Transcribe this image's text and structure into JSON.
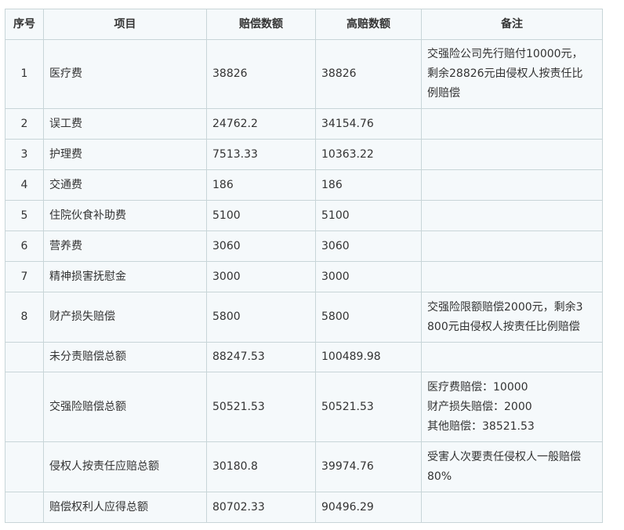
{
  "headers": [
    "序号",
    "项目",
    "赔偿数额",
    "高赔数额",
    "备注"
  ],
  "rows": [
    {
      "idx": "1",
      "item": "医疗费",
      "amount": "38826",
      "high": "38826",
      "note": [
        "交强险公司先行赔付10000元，",
        "剩余28826元由侵权人按责任比",
        "例赔偿"
      ]
    },
    {
      "idx": "2",
      "item": "误工费",
      "amount": "24762.2",
      "high": "34154.76",
      "note": []
    },
    {
      "idx": "3",
      "item": "护理费",
      "amount": "7513.33",
      "high": "10363.22",
      "note": []
    },
    {
      "idx": "4",
      "item": "交通费",
      "amount": "186",
      "high": "186",
      "note": []
    },
    {
      "idx": "5",
      "item": "住院伙食补助费",
      "amount": "5100",
      "high": "5100",
      "note": []
    },
    {
      "idx": "6",
      "item": "营养费",
      "amount": "3060",
      "high": "3060",
      "note": []
    },
    {
      "idx": "7",
      "item": "精神损害抚慰金",
      "amount": "3000",
      "high": "3000",
      "note": []
    },
    {
      "idx": "8",
      "item": "财产损失赔偿",
      "amount": "5800",
      "high": "5800",
      "note": [
        "交强险限额赔偿2000元，剩余3",
        "800元由侵权人按责任比例赔偿"
      ]
    },
    {
      "idx": "",
      "item": "未分责赔偿总额",
      "amount": "88247.53",
      "high": "100489.98",
      "note": []
    },
    {
      "idx": "",
      "item": "交强险赔偿总额",
      "amount": "50521.53",
      "high": "50521.53",
      "note": [
        "医疗费赔偿：10000",
        "财产损失赔偿：2000",
        "其他赔偿：38521.53"
      ]
    },
    {
      "idx": "",
      "item": "侵权人按责任应赔总额",
      "amount": "30180.8",
      "high": "39974.76",
      "note": [
        "受害人次要责任侵权人一般赔偿",
        "80%"
      ]
    },
    {
      "idx": "",
      "item": "赔偿权利人应得总额",
      "amount": "80702.33",
      "high": "90496.29",
      "note": []
    }
  ]
}
